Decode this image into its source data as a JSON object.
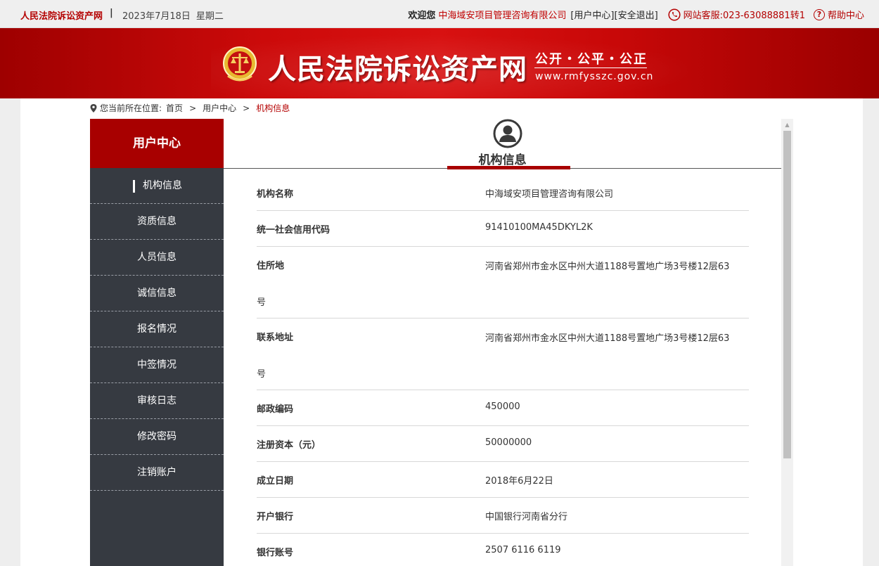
{
  "topbar": {
    "site_name": "人民法院诉讼资产网",
    "separator": "|",
    "date": "2023年7月18日",
    "weekday": "星期二",
    "welcome": "欢迎您",
    "company": "中海域安项目管理咨询有限公司",
    "user_center_link": "[用户中心]",
    "logout_link": "[安全退出]",
    "phone": "网站客服:023-63088881转1",
    "help": "帮助中心"
  },
  "banner": {
    "title": "人民法院诉讼资产网",
    "slogan": "公开・公平・公正",
    "url": "www.rmfysszc.gov.cn"
  },
  "breadcrumb": {
    "prefix": "您当前所在位置:",
    "items": [
      "首页",
      "用户中心",
      "机构信息"
    ],
    "sep": ">"
  },
  "sidebar": {
    "title": "用户中心",
    "items": [
      {
        "label": "机构信息",
        "active": true
      },
      {
        "label": "资质信息",
        "active": false
      },
      {
        "label": "人员信息",
        "active": false
      },
      {
        "label": "诚信信息",
        "active": false
      },
      {
        "label": "报名情况",
        "active": false
      },
      {
        "label": "中签情况",
        "active": false
      },
      {
        "label": "审核日志",
        "active": false
      },
      {
        "label": "修改密码",
        "active": false
      },
      {
        "label": "注销账户",
        "active": false
      }
    ]
  },
  "content": {
    "title": "机构信息",
    "rows": [
      {
        "label": "机构名称",
        "value": "中海域安项目管理咨询有限公司"
      },
      {
        "label": "统一社会信用代码",
        "value": "91410100MA45DKYL2K"
      },
      {
        "label": "住所地",
        "value": "河南省郑州市金水区中州大道1188号置地广场3号楼12层63",
        "value_cont": "号"
      },
      {
        "label": "联系地址",
        "value": "河南省郑州市金水区中州大道1188号置地广场3号楼12层63",
        "value_cont": "号"
      },
      {
        "label": "邮政编码",
        "value": "450000"
      },
      {
        "label": "注册资本（元）",
        "value": "50000000"
      },
      {
        "label": "成立日期",
        "value": "2018年6月22日"
      },
      {
        "label": "开户银行",
        "value": "中国银行河南省分行"
      },
      {
        "label": "银行账号",
        "value": "2507 6116 6119"
      }
    ]
  },
  "icons": {
    "phone": "phone-icon",
    "help": "question-icon",
    "location": "location-pin-icon",
    "user": "user-avatar-icon",
    "emblem": "court-emblem-icon"
  },
  "colors": {
    "brand_red": "#a80000",
    "sidebar_dark": "#363a41",
    "link_red": "#c00000"
  }
}
